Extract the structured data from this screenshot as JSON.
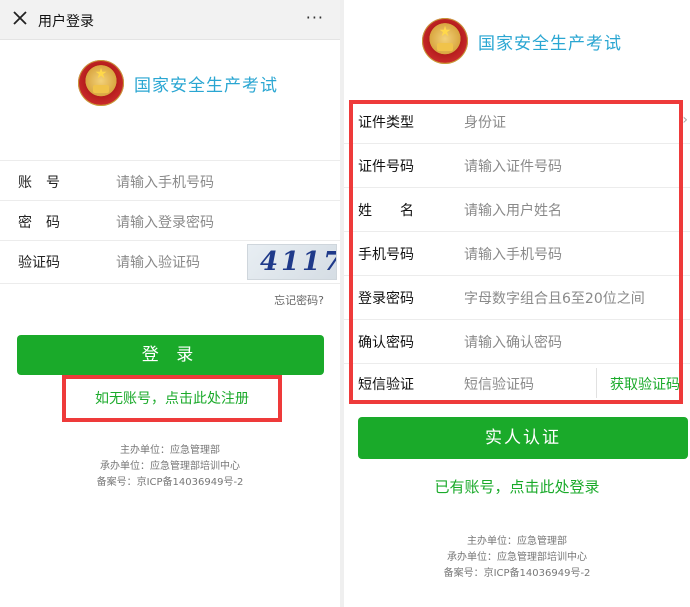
{
  "left": {
    "topbar": {
      "title": "用户登录",
      "more": "···"
    },
    "header": {
      "title": "国家安全生产考试"
    },
    "fields": [
      {
        "label": "账　号",
        "placeholder": "请输入手机号码"
      },
      {
        "label": "密　码",
        "placeholder": "请输入登录密码"
      },
      {
        "label": "验证码",
        "placeholder": "请输入验证码"
      }
    ],
    "captcha": "4117",
    "forgot": "忘记密码?",
    "login_button": "登 录",
    "register_link": "如无账号，点击此处注册",
    "footer": [
      "主办单位：应急管理部",
      "承办单位：应急管理部培训中心",
      "备案号：京ICP备14036949号-2"
    ]
  },
  "right": {
    "header": {
      "title": "国家安全生产考试"
    },
    "fields": [
      {
        "label": "证件类型",
        "placeholder": "身份证"
      },
      {
        "label": "证件号码",
        "placeholder": "请输入证件号码"
      },
      {
        "label": "姓　　名",
        "placeholder": "请输入用户姓名"
      },
      {
        "label": "手机号码",
        "placeholder": "请输入手机号码"
      },
      {
        "label": "登录密码",
        "placeholder": "字母数字组合且6至20位之间"
      },
      {
        "label": "确认密码",
        "placeholder": "请输入确认密码"
      },
      {
        "label": "短信验证",
        "placeholder": "短信验证码"
      }
    ],
    "sms_button": "获取验证码",
    "verify_button": "实人认证",
    "login_link": "已有账号，点击此处登录",
    "footer": [
      "主办单位：应急管理部",
      "承办单位：应急管理部培训中心",
      "备案号：京ICP备14036949号-2"
    ]
  },
  "colors": {
    "accent_green": "#1aaa2a",
    "title_blue": "#2aa6d2",
    "highlight_red": "#ee3a3a"
  }
}
